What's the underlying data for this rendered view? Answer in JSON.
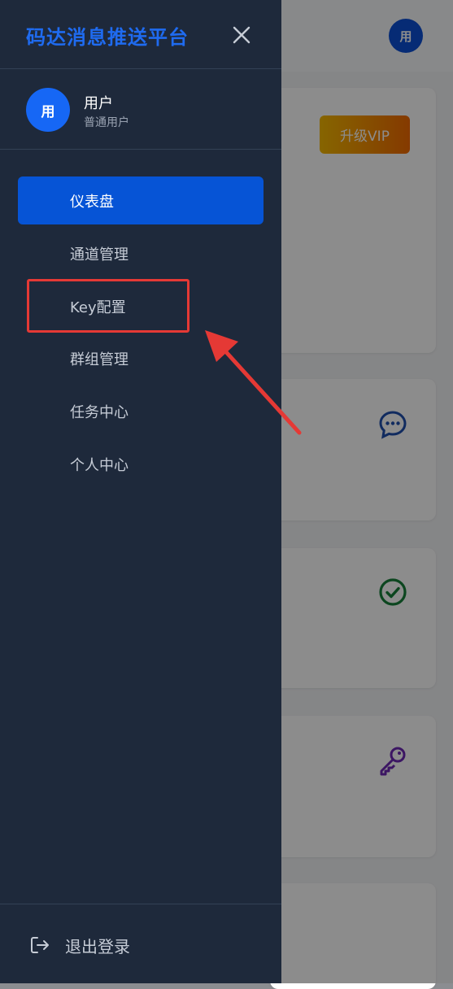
{
  "background": {
    "avatar_text": "用",
    "vip_label": "升级VIP",
    "card_icons": [
      "chat-icon",
      "check-circle-icon",
      "key-icon"
    ]
  },
  "drawer": {
    "brand": "码达消息推送平台",
    "close_icon": "close-icon",
    "user": {
      "avatar_text": "用",
      "name": "用户",
      "role": "普通用户"
    },
    "nav": [
      {
        "label": "仪表盘",
        "active": true
      },
      {
        "label": "通道管理",
        "active": false
      },
      {
        "label": "Key配置",
        "active": false,
        "highlighted": true
      },
      {
        "label": "群组管理",
        "active": false
      },
      {
        "label": "任务中心",
        "active": false
      },
      {
        "label": "个人中心",
        "active": false
      }
    ],
    "logout_label": "退出登录"
  },
  "colors": {
    "drawer_bg": "#1e293b",
    "accent": "#0654d6",
    "brand": "#1f6bf0",
    "highlight": "#e53935"
  }
}
